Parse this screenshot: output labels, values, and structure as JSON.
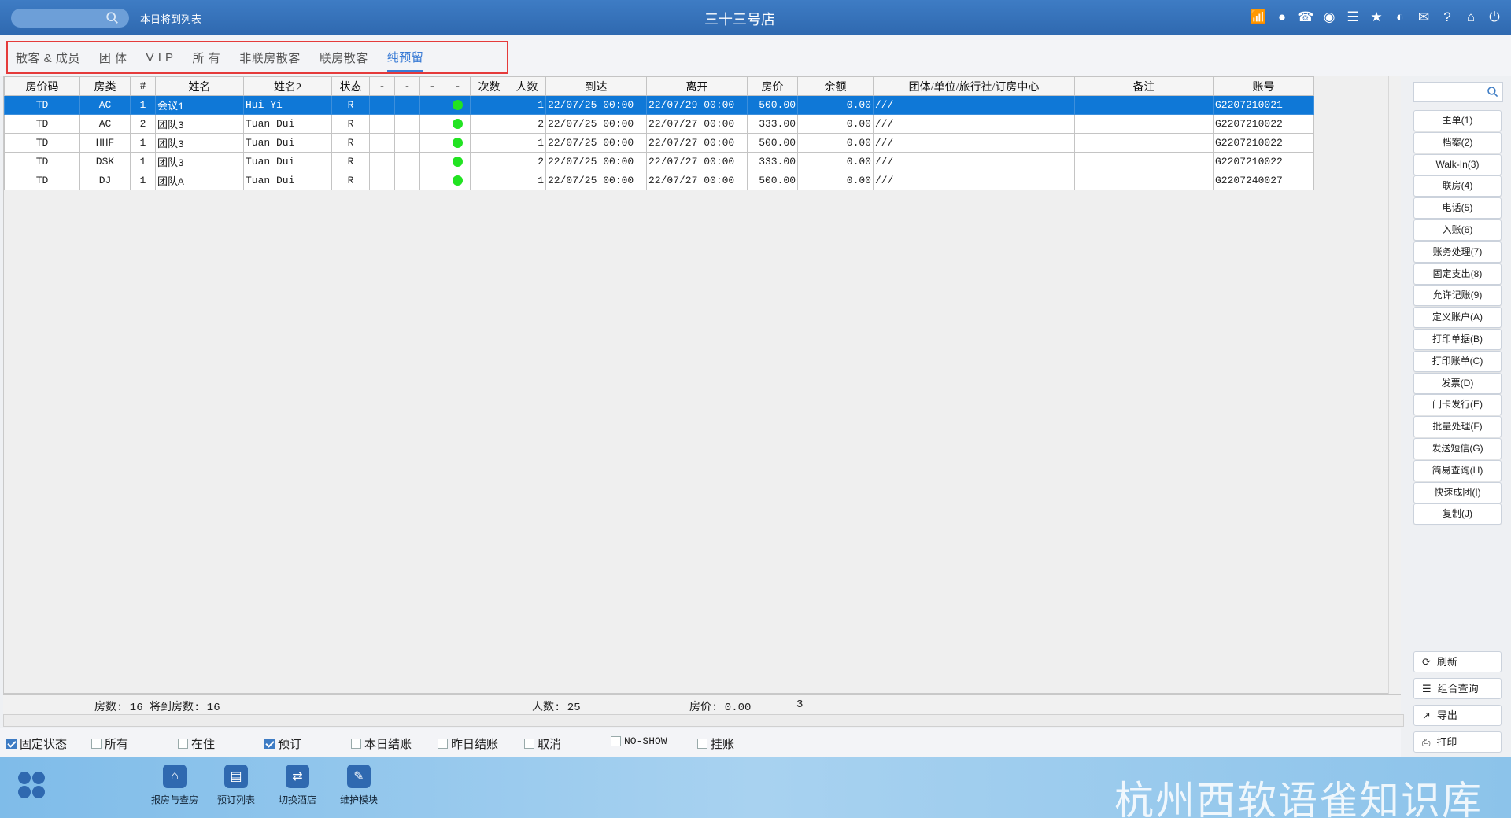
{
  "topbar": {
    "search_placeholder": "",
    "left_label": "本日将到列表",
    "title": "三十三号店",
    "icons": [
      "wifi-icon",
      "chat-icon",
      "phone-icon",
      "palette-icon",
      "menu-icon",
      "star-icon",
      "theme-icon",
      "mail-icon",
      "help-icon",
      "home-icon",
      "power-icon"
    ]
  },
  "tabs": [
    {
      "label": "散客 & 成员",
      "active": false
    },
    {
      "label": "团 体",
      "active": false
    },
    {
      "label": "V I P",
      "active": false
    },
    {
      "label": "所 有",
      "active": false
    },
    {
      "label": "非联房散客",
      "active": false
    },
    {
      "label": "联房散客",
      "active": false
    },
    {
      "label": "纯预留",
      "active": true
    }
  ],
  "grid": {
    "columns": [
      "房价码",
      "房类",
      "#",
      "姓名",
      "姓名2",
      "状态",
      "-",
      "-",
      "-",
      "-",
      "次数",
      "人数",
      "到达",
      "离开",
      "房价",
      "余额",
      "团体/单位/旅行社/订房中心",
      "备注",
      "账号"
    ],
    "rows": [
      {
        "selected": true,
        "cells": [
          "TD",
          "AC",
          "1",
          "会议1",
          "Hui Yi",
          "R",
          "",
          "",
          "",
          "●",
          "",
          "1",
          "22/07/25 00:00",
          "22/07/29 00:00",
          "500.00",
          "0.00",
          "///",
          "",
          "G2207210021"
        ]
      },
      {
        "selected": false,
        "cells": [
          "TD",
          "AC",
          "2",
          "团队3",
          "Tuan Dui",
          "R",
          "",
          "",
          "",
          "●",
          "",
          "2",
          "22/07/25 00:00",
          "22/07/27 00:00",
          "333.00",
          "0.00",
          "///",
          "",
          "G2207210022"
        ]
      },
      {
        "selected": false,
        "cells": [
          "TD",
          "HHF",
          "1",
          "团队3",
          "Tuan Dui",
          "R",
          "",
          "",
          "",
          "●",
          "",
          "1",
          "22/07/25 00:00",
          "22/07/27 00:00",
          "500.00",
          "0.00",
          "///",
          "",
          "G2207210022"
        ]
      },
      {
        "selected": false,
        "cells": [
          "TD",
          "DSK",
          "1",
          "团队3",
          "Tuan Dui",
          "R",
          "",
          "",
          "",
          "●",
          "",
          "2",
          "22/07/25 00:00",
          "22/07/27 00:00",
          "333.00",
          "0.00",
          "///",
          "",
          "G2207210022"
        ]
      },
      {
        "selected": false,
        "cells": [
          "TD",
          "DJ",
          "1",
          "团队A",
          "Tuan Dui",
          "R",
          "",
          "",
          "",
          "●",
          "",
          "1",
          "22/07/25 00:00",
          "22/07/27 00:00",
          "500.00",
          "0.00",
          "///",
          "",
          "G2207240027"
        ]
      }
    ]
  },
  "summary": {
    "rooms": "房数: 16 将到房数: 16",
    "people": "人数: 25",
    "price": "房价: 0.00",
    "extra": "3"
  },
  "filters": [
    {
      "label": "固定状态",
      "checked": true
    },
    {
      "label": "所有",
      "checked": false
    },
    {
      "label": "在住",
      "checked": false
    },
    {
      "label": "预订",
      "checked": true
    },
    {
      "label": "本日结账",
      "checked": false
    },
    {
      "label": "昨日结账",
      "checked": false
    },
    {
      "label": "取消",
      "checked": false
    },
    {
      "label": "NO-SHOW",
      "checked": false
    },
    {
      "label": "挂账",
      "checked": false
    }
  ],
  "side": {
    "buttons": [
      "主单(1)",
      "档案(2)",
      "Walk-In(3)",
      "联房(4)",
      "电话(5)",
      "入账(6)",
      "账务处理(7)",
      "固定支出(8)",
      "允许记账(9)",
      "定义账户(A)",
      "打印单据(B)",
      "打印账单(C)",
      "发票(D)",
      "门卡发行(E)",
      "批量处理(F)",
      "发送短信(G)",
      "简易查询(H)",
      "快速成团(I)",
      "复制(J)"
    ],
    "bottom_buttons": [
      {
        "icon": "refresh-icon",
        "label": "刷新",
        "glyph": "⟳"
      },
      {
        "icon": "list-icon",
        "label": "组合查询",
        "glyph": "☰"
      },
      {
        "icon": "export-icon",
        "label": "导出",
        "glyph": "↗"
      },
      {
        "icon": "print-icon",
        "label": "打印",
        "glyph": "⎙"
      }
    ]
  },
  "taskbar": {
    "items": [
      {
        "label": "报房与查房",
        "icon": "house-search-icon",
        "glyph": "⌂"
      },
      {
        "label": "预订列表",
        "icon": "booking-list-icon",
        "glyph": "▤"
      },
      {
        "label": "切换酒店",
        "icon": "switch-hotel-icon",
        "glyph": "⇄"
      },
      {
        "label": "维护模块",
        "icon": "wrench-icon",
        "glyph": "✎"
      }
    ],
    "watermark": "杭州西软语雀知识库"
  },
  "colors": {
    "accent": "#3e7cc4",
    "selected_row": "#0f78d7",
    "status_dot": "#22e322",
    "tab_highlight_border": "#e53b3b"
  }
}
